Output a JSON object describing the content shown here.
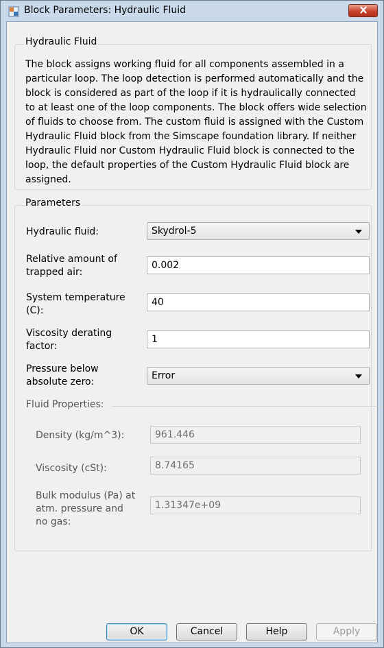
{
  "window": {
    "title": "Block Parameters: Hydraulic Fluid"
  },
  "description": {
    "group_title": "Hydraulic Fluid",
    "text": "The block assigns working fluid for all components assembled in a particular loop. The loop detection is performed automatically and the block is considered as part of the loop if it is hydraulically connected to at least one of the loop components. The block offers wide selection of fluids to choose from. The custom fluid is assigned with the Custom Hydraulic Fluid block from the Simscape foundation library. If neither Hydraulic Fluid nor Custom Hydraulic Fluid block is connected to the loop, the default properties of the Custom Hydraulic Fluid block are assigned."
  },
  "parameters": {
    "group_title": "Parameters",
    "hydraulic_fluid": {
      "label": "Hydraulic fluid:",
      "value": "Skydrol-5"
    },
    "trapped_air": {
      "label_line1": "Relative amount of",
      "label_line2": "trapped air:",
      "value": "0.002"
    },
    "system_temperature": {
      "label_line1": "System temperature",
      "label_line2": "(C):",
      "value": "40"
    },
    "viscosity_derating": {
      "label_line1": "Viscosity derating",
      "label_line2": "factor:",
      "value": "1"
    },
    "pressure_below_zero": {
      "label_line1": "Pressure below",
      "label_line2": "absolute zero:",
      "value": "Error"
    }
  },
  "fluid_properties": {
    "title": "Fluid Properties:",
    "density": {
      "label": "Density (kg/m^3):",
      "value": "961.446"
    },
    "viscosity": {
      "label": "Viscosity (cSt):",
      "value": "8.74165"
    },
    "bulk_modulus": {
      "label_line1": "Bulk modulus (Pa) at",
      "label_line2": "atm. pressure and",
      "label_line3": "no gas:",
      "value": "1.31347e+09"
    }
  },
  "buttons": {
    "ok": "OK",
    "cancel": "Cancel",
    "help": "Help",
    "apply": "Apply"
  },
  "icons": {
    "window_icon": "simulink-block-icon",
    "close_icon": "close-icon"
  },
  "colors": {
    "title_bar": "#c9d9ea",
    "close_button": "#c7432c",
    "content_bg": "#f0f0f0"
  }
}
